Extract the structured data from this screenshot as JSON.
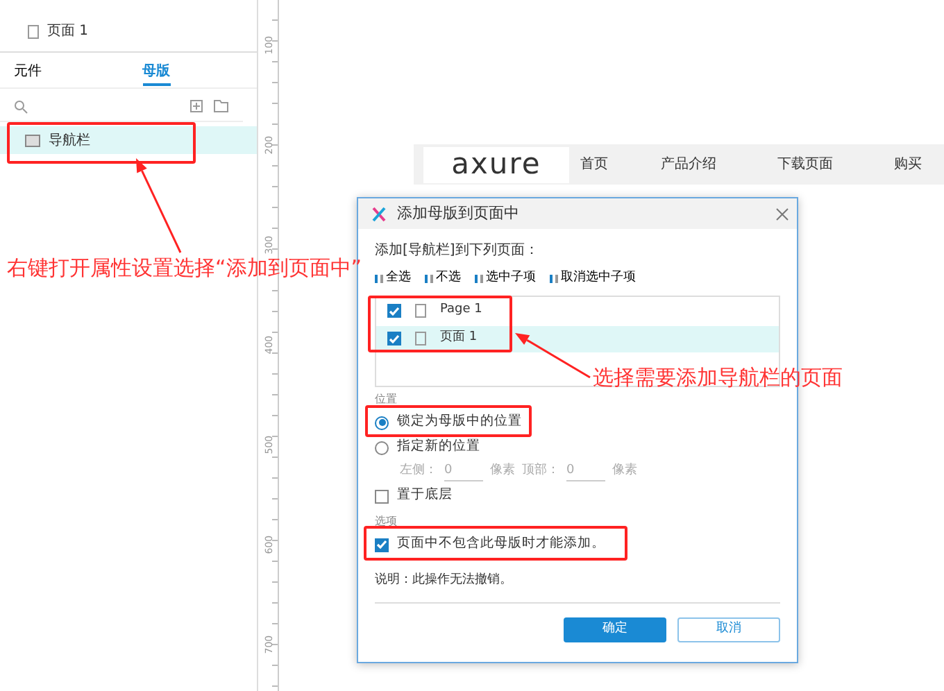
{
  "left_panel": {
    "pages": [
      {
        "label": "页面 1"
      }
    ],
    "tabs": [
      {
        "label": "元件",
        "selected": false
      },
      {
        "label": "母版",
        "selected": true
      }
    ],
    "masters": [
      {
        "label": "导航栏",
        "selected": true
      }
    ]
  },
  "ruler": {
    "labels": [
      "100",
      "200",
      "300",
      "400",
      "500",
      "600",
      "700"
    ]
  },
  "canvas": {
    "logo": "axure",
    "nav_items": [
      "首页",
      "产品介绍",
      "下载页面",
      "购买"
    ]
  },
  "dialog": {
    "title": "添加母版到页面中",
    "prompt": "添加[导航栏]到下列页面：",
    "tools": [
      "全选",
      "不选",
      "选中子项",
      "取消选中子项"
    ],
    "pages": [
      {
        "label": "Page 1",
        "checked": true,
        "selected": false
      },
      {
        "label": "页面 1",
        "checked": true,
        "selected": true
      }
    ],
    "position": {
      "label": "位置",
      "options": [
        {
          "label": "锁定为母版中的位置",
          "selected": true
        },
        {
          "label": "指定新的位置",
          "selected": false
        }
      ],
      "offset": {
        "disabled": true,
        "left_label": "左侧：",
        "left_value": "0",
        "left_unit": "像素",
        "top_label": "顶部：",
        "top_value": "0",
        "top_unit": "像素"
      },
      "bottom_layer": {
        "label": "置于底层",
        "checked": false
      }
    },
    "options": {
      "label": "选项",
      "only_if_absent": {
        "label": "页面中不包含此母版时才能添加。",
        "checked": true
      }
    },
    "note": "说明：此操作无法撤销。",
    "buttons": [
      {
        "label": "确定",
        "kind": "primary"
      },
      {
        "label": "取消",
        "kind": "secondary"
      }
    ]
  },
  "annotations": [
    {
      "text": "右键打开属性设置选择“添加到页面中”"
    },
    {
      "text": "选择需要添加导航栏的页面"
    }
  ]
}
